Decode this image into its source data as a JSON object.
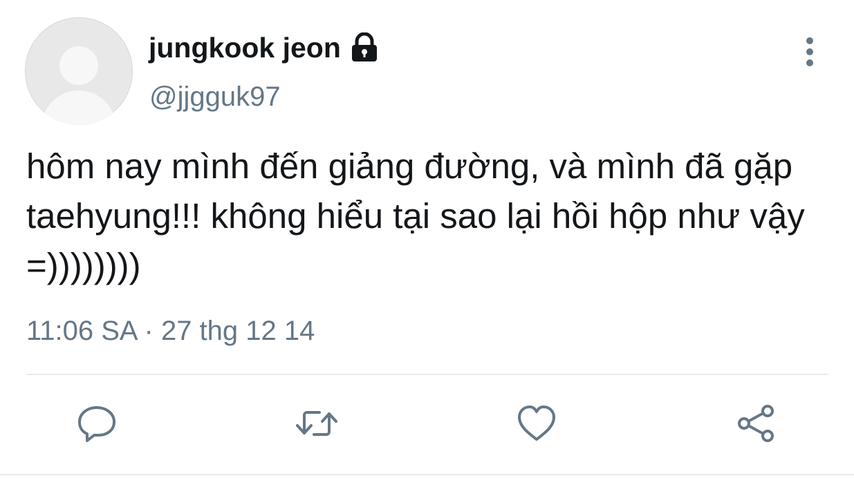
{
  "user": {
    "display_name": "jungkook jeon",
    "handle": "@jjgguk97",
    "protected_icon": "lock-icon"
  },
  "tweet": {
    "text": "hôm nay mình đến giảng đường, và mình đã gặp taehyung!!! không hiểu tại sao lại hồi hộp như vậy =))))))))",
    "timestamp": "11:06 SA · 27 thg 12 14"
  },
  "actions": {
    "reply_icon": "reply-icon",
    "retweet_icon": "retweet-icon",
    "like_icon": "heart-icon",
    "share_icon": "share-icon"
  },
  "colors": {
    "text_primary": "#14171a",
    "text_secondary": "#657786",
    "icon": "#657786",
    "divider": "#e6ecf0"
  }
}
